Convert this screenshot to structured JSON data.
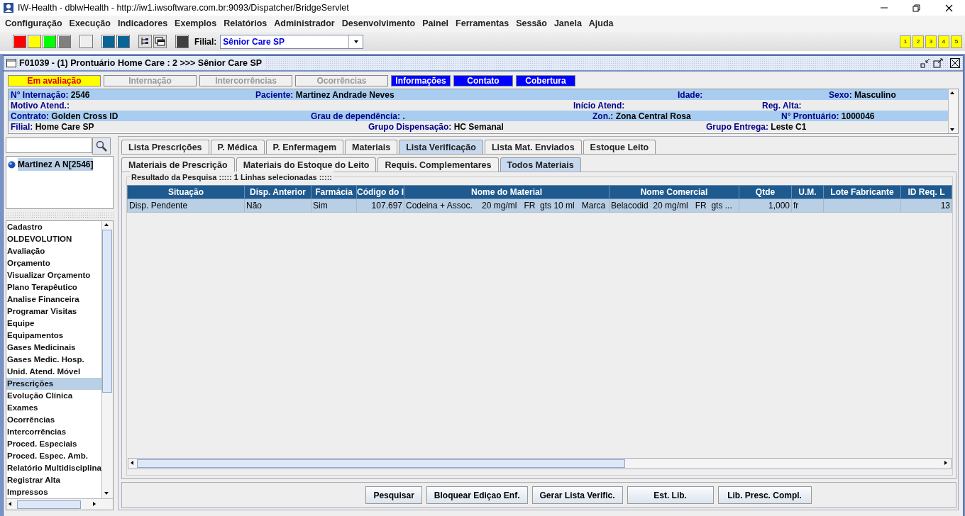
{
  "window": {
    "title": "IW-Health - dblwHealth - http://iw1.iwsoftware.com.br:9093/Dispatcher/BridgeServlet"
  },
  "menu": [
    "Configuração",
    "Execução",
    "Indicadores",
    "Exemplos",
    "Relatórios",
    "Administrador",
    "Desenvolvimento",
    "Painel",
    "Ferramentas",
    "Sessão",
    "Janela",
    "Ajuda"
  ],
  "toolbar": {
    "items": [
      {
        "kind": "swatch",
        "color": "#ff0000"
      },
      {
        "kind": "swatch",
        "color": "#ffff00"
      },
      {
        "kind": "swatch",
        "color": "#00ff00"
      },
      {
        "kind": "swatch",
        "color": "#808080"
      },
      {
        "kind": "gap"
      },
      {
        "kind": "swatch",
        "color": "#eeeeee"
      },
      {
        "kind": "gap"
      },
      {
        "kind": "swatch",
        "color": "#0a6496"
      },
      {
        "kind": "swatch",
        "color": "#0a6496"
      },
      {
        "kind": "gap"
      },
      {
        "kind": "tree-tool"
      },
      {
        "kind": "window-tool"
      },
      {
        "kind": "gap"
      },
      {
        "kind": "swatch",
        "color": "#404040"
      }
    ],
    "filial_label": "Filial:",
    "filial_value": "Sênior Care SP",
    "pages": [
      "1",
      "2",
      "3",
      "4",
      "5"
    ]
  },
  "frame": {
    "title": "F01039 - (1) Prontuário Home Care : 2 >>> Sênior Care SP"
  },
  "status_tabs": [
    {
      "label": "Em avaliação",
      "kind": "alert"
    },
    {
      "label": "Internação",
      "kind": "disabled"
    },
    {
      "label": "Intercorrências",
      "kind": "disabled"
    },
    {
      "label": "Ocorrências",
      "kind": "disabled"
    },
    {
      "label": "Informações",
      "kind": "active"
    },
    {
      "label": "Contato",
      "kind": "active"
    },
    {
      "label": "Cobertura",
      "kind": "active"
    }
  ],
  "patient_info": [
    [
      {
        "label": "N° Internação:",
        "value": "2546"
      },
      {
        "label": "Paciente:",
        "value": "Martinez Andrade Neves"
      },
      {
        "label": "Idade:"
      },
      {
        "label": "Sexo:",
        "value": "Masculino"
      }
    ],
    [
      {
        "label": "Motivo Atend.:"
      },
      {
        "label": "Início Atend:"
      },
      {
        "label": "Reg. Alta:"
      }
    ],
    [
      {
        "label": "Contrato:",
        "value": "Golden Cross ID"
      },
      {
        "label": "Grau de dependência:",
        "value": "."
      },
      {
        "label": "Zon.:",
        "value": "Zona Central Rosa"
      },
      {
        "label": "N° Prontuário:",
        "value": "1000046"
      }
    ],
    [
      {
        "label": "Filial:",
        "value": "Home Care SP"
      },
      {
        "label": "Grupo Dispensação:",
        "value": "HC Semanal"
      },
      {
        "label": "Grupo Entrega:",
        "value": "Leste C1"
      }
    ]
  ],
  "patients": [
    {
      "label": "Martinez A N[2546]",
      "selected": true
    }
  ],
  "nav_items": [
    {
      "label": "Cadastro",
      "selected": false
    },
    {
      "label": "OLDEVOLUTION",
      "selected": false
    },
    {
      "label": "Avaliação",
      "selected": false
    },
    {
      "label": "Orçamento",
      "selected": false
    },
    {
      "label": "Visualizar Orçamento",
      "selected": false
    },
    {
      "label": "Plano Terapêutico",
      "selected": false
    },
    {
      "label": "Analise Financeira",
      "selected": false
    },
    {
      "label": "Programar Visitas",
      "selected": false
    },
    {
      "label": "Equipe",
      "selected": false
    },
    {
      "label": "Equipamentos",
      "selected": false
    },
    {
      "label": "Gases Medicinais",
      "selected": false
    },
    {
      "label": "Gases Medic. Hosp.",
      "selected": false
    },
    {
      "label": "Unid. Atend. Móvel",
      "selected": false
    },
    {
      "label": "Prescrições",
      "selected": true
    },
    {
      "label": "Evolução Clínica",
      "selected": false
    },
    {
      "label": "Exames",
      "selected": false
    },
    {
      "label": "Ocorrências",
      "selected": false
    },
    {
      "label": "Intercorrências",
      "selected": false
    },
    {
      "label": "Proced. Especiais",
      "selected": false
    },
    {
      "label": "Proced. Espec. Amb.",
      "selected": false
    },
    {
      "label": "Relatório Multidisciplina",
      "selected": false
    },
    {
      "label": "Registrar Alta",
      "selected": false
    },
    {
      "label": "Impressos",
      "selected": false
    }
  ],
  "tabs": [
    {
      "label": "Lista Prescrições",
      "selected": false
    },
    {
      "label": "P. Médica",
      "selected": false
    },
    {
      "label": "P. Enfermagem",
      "selected": false
    },
    {
      "label": "Materiais",
      "selected": false
    },
    {
      "label": "Lista Verificação",
      "selected": true
    },
    {
      "label": "Lista Mat. Enviados",
      "selected": false
    },
    {
      "label": "Estoque Leito",
      "selected": false
    }
  ],
  "subtabs": [
    {
      "label": "Materiais de Prescrição",
      "selected": false
    },
    {
      "label": "Materiais do Estoque do Leito",
      "selected": false
    },
    {
      "label": "Requis. Complementares",
      "selected": false
    },
    {
      "label": "Todos Materiais",
      "selected": true
    }
  ],
  "results": {
    "title": "Resultado da Pesquisa ::::: 1 Linhas selecionadas :::::",
    "columns": [
      "Situação",
      "Disp. Anterior",
      "Farmácia",
      "Código do I",
      "Nome do Material",
      "Nome Comercial",
      "Qtde",
      "U.M.",
      "Lote Fabricante",
      "ID Req. L"
    ],
    "rows": [
      {
        "selected": true,
        "cells": [
          "Disp. Pendente",
          "Não",
          "Sim",
          "107.697",
          "Codeina + Assoc.    20 mg/ml   FR  gts 10 ml   Marca",
          "Belacodid  20 mg/ml   FR  gts ...",
          "1,000",
          "fr",
          "",
          "13"
        ]
      }
    ]
  },
  "buttons": [
    "Pesquisar",
    "Bloquear Ediçao Enf.",
    "Gerar Lista Verific.",
    "Est. Lib.",
    "Lib. Presc. Compl."
  ]
}
